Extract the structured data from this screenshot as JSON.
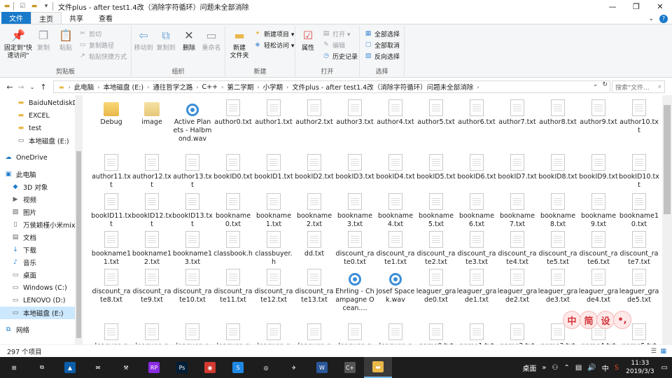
{
  "window": {
    "title": "文件plus - after test1.4改（消除字符循环）问题未全部消除",
    "controls": {
      "minimize": "—",
      "maximize": "❐",
      "close": "✕"
    }
  },
  "tabs": [
    "文件",
    "主页",
    "共享",
    "查看"
  ],
  "ribbon": {
    "clipboard": {
      "label": "剪贴板",
      "pin": "固定到\"快速访问\"",
      "copy": "复制",
      "paste": "粘贴",
      "cut": "剪切",
      "copy_path": "复制路径",
      "paste_shortcut": "粘贴快捷方式"
    },
    "organize": {
      "label": "组织",
      "move_to": "移动到",
      "copy_to": "复制到",
      "delete": "删除",
      "rename": "重命名"
    },
    "new": {
      "label": "新建",
      "new_folder": "新建\n文件夹",
      "new_item": "新建项目 ▾",
      "easy_access": "轻松访问 ▾"
    },
    "open": {
      "label": "打开",
      "properties": "属性",
      "open": "打开 ▾",
      "edit": "编辑",
      "history": "历史记录"
    },
    "select": {
      "label": "选择",
      "select_all": "全部选择",
      "select_none": "全部取消",
      "invert": "反向选择"
    }
  },
  "address": {
    "crumbs": [
      "此电脑",
      "本地磁盘 (E:)",
      "通往哲学之路",
      "C++",
      "第二学期",
      "小学期",
      "文件plus - after test1.4改（消除字符循环）问题未全部消除"
    ],
    "search_placeholder": "搜索\"文件..."
  },
  "nav_pane": [
    {
      "label": "BaiduNetdiskDo",
      "icon": "folder-icon"
    },
    {
      "label": "EXCEL",
      "icon": "folder-icon"
    },
    {
      "label": "test",
      "icon": "folder-icon"
    },
    {
      "label": "本地磁盘 (E:)",
      "icon": "drive-icon"
    },
    {
      "label": "OneDrive",
      "icon": "cloud-icon"
    },
    {
      "label": "此电脑",
      "icon": "computer-icon"
    },
    {
      "label": "3D 对象",
      "icon": "cube-icon"
    },
    {
      "label": "视频",
      "icon": "video-icon"
    },
    {
      "label": "图片",
      "icon": "picture-icon"
    },
    {
      "label": "万侯颖槿小米mix",
      "icon": "phone-icon"
    },
    {
      "label": "文档",
      "icon": "document-icon"
    },
    {
      "label": "下载",
      "icon": "download-icon"
    },
    {
      "label": "音乐",
      "icon": "music-icon"
    },
    {
      "label": "桌面",
      "icon": "desktop-icon"
    },
    {
      "label": "Windows (C:)",
      "icon": "drive-icon"
    },
    {
      "label": "LENOVO (D:)",
      "icon": "drive-icon"
    },
    {
      "label": "本地磁盘 (E:)",
      "icon": "drive-icon"
    },
    {
      "label": "网络",
      "icon": "network-icon"
    }
  ],
  "files": [
    {
      "name": "Debug",
      "type": "folder"
    },
    {
      "name": "image",
      "type": "folder2"
    },
    {
      "name": "Active Planets - Halbmond.wav",
      "type": "wav"
    },
    {
      "name": "author0.txt",
      "type": "doc"
    },
    {
      "name": "author1.txt",
      "type": "doc"
    },
    {
      "name": "author2.txt",
      "type": "doc"
    },
    {
      "name": "author3.txt",
      "type": "doc"
    },
    {
      "name": "author4.txt",
      "type": "doc"
    },
    {
      "name": "author5.txt",
      "type": "doc"
    },
    {
      "name": "author6.txt",
      "type": "doc"
    },
    {
      "name": "author7.txt",
      "type": "doc"
    },
    {
      "name": "author8.txt",
      "type": "doc"
    },
    {
      "name": "author9.txt",
      "type": "doc"
    },
    {
      "name": "author10.txt",
      "type": "doc"
    },
    {
      "name": "author11.txt",
      "type": "doc"
    },
    {
      "name": "author12.txt",
      "type": "doc"
    },
    {
      "name": "author13.txt",
      "type": "doc"
    },
    {
      "name": "bookID0.txt",
      "type": "doc"
    },
    {
      "name": "bookID1.txt",
      "type": "doc"
    },
    {
      "name": "bookID2.txt",
      "type": "doc"
    },
    {
      "name": "bookID3.txt",
      "type": "doc"
    },
    {
      "name": "bookID4.txt",
      "type": "doc"
    },
    {
      "name": "bookID5.txt",
      "type": "doc"
    },
    {
      "name": "bookID6.txt",
      "type": "doc"
    },
    {
      "name": "bookID7.txt",
      "type": "doc"
    },
    {
      "name": "bookID8.txt",
      "type": "doc"
    },
    {
      "name": "bookID9.txt",
      "type": "doc"
    },
    {
      "name": "bookID10.txt",
      "type": "doc"
    },
    {
      "name": "bookID11.txt",
      "type": "doc"
    },
    {
      "name": "bookID12.txt",
      "type": "doc"
    },
    {
      "name": "bookID13.txt",
      "type": "doc"
    },
    {
      "name": "bookname0.txt",
      "type": "doc"
    },
    {
      "name": "bookname1.txt",
      "type": "doc"
    },
    {
      "name": "bookname2.txt",
      "type": "doc"
    },
    {
      "name": "bookname3.txt",
      "type": "doc"
    },
    {
      "name": "bookname4.txt",
      "type": "doc"
    },
    {
      "name": "bookname5.txt",
      "type": "doc"
    },
    {
      "name": "bookname6.txt",
      "type": "doc"
    },
    {
      "name": "bookname7.txt",
      "type": "doc"
    },
    {
      "name": "bookname8.txt",
      "type": "doc"
    },
    {
      "name": "bookname9.txt",
      "type": "doc"
    },
    {
      "name": "bookname10.txt",
      "type": "doc"
    },
    {
      "name": "bookname11.txt",
      "type": "doc"
    },
    {
      "name": "bookname12.txt",
      "type": "doc"
    },
    {
      "name": "bookname13.txt",
      "type": "doc"
    },
    {
      "name": "classbook.h",
      "type": "doc"
    },
    {
      "name": "classbuyer.h",
      "type": "doc"
    },
    {
      "name": "dd.txt",
      "type": "doc"
    },
    {
      "name": "discount_rate0.txt",
      "type": "doc"
    },
    {
      "name": "discount_rate1.txt",
      "type": "doc"
    },
    {
      "name": "discount_rate2.txt",
      "type": "doc"
    },
    {
      "name": "discount_rate3.txt",
      "type": "doc"
    },
    {
      "name": "discount_rate4.txt",
      "type": "doc"
    },
    {
      "name": "discount_rate5.txt",
      "type": "doc"
    },
    {
      "name": "discount_rate6.txt",
      "type": "doc"
    },
    {
      "name": "discount_rate7.txt",
      "type": "doc"
    },
    {
      "name": "discount_rate8.txt",
      "type": "doc"
    },
    {
      "name": "discount_rate9.txt",
      "type": "doc"
    },
    {
      "name": "discount_rate10.txt",
      "type": "doc"
    },
    {
      "name": "discount_rate11.txt",
      "type": "doc"
    },
    {
      "name": "discount_rate12.txt",
      "type": "doc"
    },
    {
      "name": "discount_rate13.txt",
      "type": "doc"
    },
    {
      "name": "Ehrling - Champagne Ocean....",
      "type": "wav"
    },
    {
      "name": "Josef Spacek.wav",
      "type": "wav"
    },
    {
      "name": "leaguer_grade0.txt",
      "type": "doc"
    },
    {
      "name": "leaguer_grade1.txt",
      "type": "doc"
    },
    {
      "name": "leaguer_grade2.txt",
      "type": "doc"
    },
    {
      "name": "leaguer_grade3.txt",
      "type": "doc"
    },
    {
      "name": "leaguer_grade4.txt",
      "type": "doc"
    },
    {
      "name": "leaguer_grade5.txt",
      "type": "doc"
    },
    {
      "name": "leaguer_g",
      "type": "doc"
    },
    {
      "name": "leaguer_g",
      "type": "doc"
    },
    {
      "name": "leaguer_g",
      "type": "doc"
    },
    {
      "name": "leaguer_g",
      "type": "doc"
    },
    {
      "name": "leaguer_g",
      "type": "doc"
    },
    {
      "name": "leaguer_g",
      "type": "doc"
    },
    {
      "name": "leaguer_g",
      "type": "doc"
    },
    {
      "name": "leaguer_g",
      "type": "doc"
    },
    {
      "name": "name0.txt",
      "type": "doc"
    },
    {
      "name": "name1.txt",
      "type": "doc"
    },
    {
      "name": "name2.txt",
      "type": "doc"
    },
    {
      "name": "name3.txt",
      "type": "doc"
    },
    {
      "name": "name4.txt",
      "type": "doc"
    },
    {
      "name": "name5.txt",
      "type": "doc"
    }
  ],
  "status": {
    "count": "297 个项目"
  },
  "sticker": [
    "中",
    "简",
    "设",
    "•,"
  ],
  "taskbar": {
    "apps": [
      {
        "name": "start-button",
        "glyph": "⊞"
      },
      {
        "name": "task-view-button",
        "glyph": "⧉"
      },
      {
        "name": "photos-app",
        "glyph": "▲"
      },
      {
        "name": "mail-app",
        "glyph": "✉"
      },
      {
        "name": "tools-app",
        "glyph": "⚒"
      },
      {
        "name": "rp-app",
        "glyph": "RP"
      },
      {
        "name": "photoshop-app",
        "glyph": "Ps"
      },
      {
        "name": "netease-music-app",
        "glyph": "◉"
      },
      {
        "name": "sogou-app",
        "glyph": "S"
      },
      {
        "name": "media-app",
        "glyph": "◎"
      },
      {
        "name": "bird-app",
        "glyph": "✈"
      },
      {
        "name": "word-app",
        "glyph": "W"
      },
      {
        "name": "devcpp-app",
        "glyph": "C+"
      },
      {
        "name": "file-explorer-app",
        "glyph": "▬"
      }
    ],
    "desktop_label": "桌面",
    "ime": "中",
    "time": "11:33",
    "date": "2019/3/3"
  }
}
